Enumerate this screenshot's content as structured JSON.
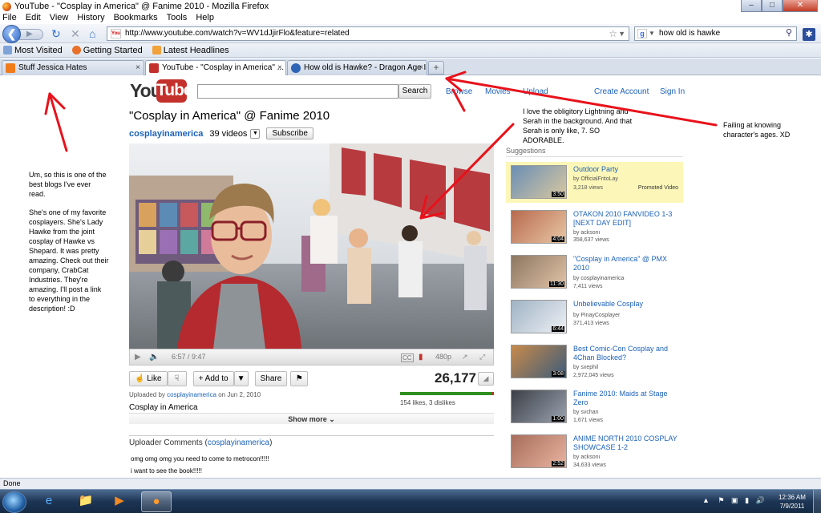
{
  "window": {
    "title": "YouTube - \"Cosplay in America\" @ Fanime 2010 - Mozilla Firefox",
    "min": "–",
    "max": "□",
    "close": "✕"
  },
  "menu": [
    "File",
    "Edit",
    "View",
    "History",
    "Bookmarks",
    "Tools",
    "Help"
  ],
  "nav": {
    "url": "http://www.youtube.com/watch?v=WV1dJjirFlo&feature=related",
    "search_value": "how old is hawke"
  },
  "bookmarks": [
    {
      "label": "Most Visited",
      "color": "#7da3d8"
    },
    {
      "label": "Getting Started",
      "color": "#e8702a"
    },
    {
      "label": "Latest Headlines",
      "color": "#f2a23a"
    }
  ],
  "tabs": [
    {
      "label": "Stuff Jessica Hates",
      "close": "×",
      "color": "#f07c1c"
    },
    {
      "label": "YouTube - \"Cosplay in America\" ...",
      "close": "×",
      "color": "#c4302b"
    },
    {
      "label": "How old is Hawke? - Dragon Age II ...",
      "close": "×",
      "color": "#2e64b5"
    }
  ],
  "youtube": {
    "logo_you": "You",
    "logo_tube": "Tube",
    "search_button": "Search",
    "links": [
      "Browse",
      "Movies",
      "Upload"
    ],
    "create_account": "Create Account",
    "sign_in": "Sign In",
    "video": {
      "title": "\"Cosplay in America\" @ Fanime 2010",
      "channel": "cosplayinamerica",
      "video_count": "39 videos",
      "subscribe": "Subscribe",
      "time": "6:57 / 9:47",
      "quality": "480p",
      "like": "Like",
      "add_to": "Add to",
      "share": "Share",
      "views": "26,177",
      "uploaded_prefix": "Uploaded by",
      "uploaded_by": "cosplayinamerica",
      "uploaded_on": "on Jun 2, 2010",
      "likes_text": "154 likes, 3 dislikes",
      "like_ratio": 0.98,
      "description": "Cosplay in America",
      "show_more": "Show more",
      "comments_title": "Uploader Comments",
      "comments_user": "cosplayinamerica",
      "comments": [
        "omg omg omg you need to come to metrocon!!!!!",
        "i want to see the book!!!!!"
      ]
    },
    "suggestions_title": "Suggestions",
    "suggestions": [
      {
        "title": "Outdoor Party",
        "by": "by OfficialFritoLay",
        "views": "3,218 views",
        "duration": "3:50",
        "promoted": "Promoted Video",
        "thumb": "#6b8fb5"
      },
      {
        "title": "OTAKON 2010 FANVIDEO 1-3 [NEXT DAY EDIT]",
        "by": "by acksonı",
        "views": "358,637 views",
        "duration": "4:04",
        "thumb": "#b96a4e"
      },
      {
        "title": "\"Cosplay in America\" @ PMX 2010",
        "by": "by cosplayinamerica",
        "views": "7,411 views",
        "duration": "11:30",
        "thumb": "#8c7660"
      },
      {
        "title": "Unbelievable Cosplay",
        "by": "by PinayCosplayer",
        "views": "371,413 views",
        "duration": "6:44",
        "thumb": "#9fb3c4"
      },
      {
        "title": "Best Comic-Con Cosplay and 4Chan Blocked?",
        "by": "by sxephil",
        "views": "2,972,045 views",
        "duration": "3:08",
        "thumb": "#c78a4a"
      },
      {
        "title": "Fanime 2010: Maids at Stage Zero",
        "by": "by svchan",
        "views": "1,671 views",
        "duration": "1:00",
        "thumb": "#3c3f47"
      },
      {
        "title": "ANIME NORTH 2010 COSPLAY SHOWCASE 1-2",
        "by": "by acksonı",
        "views": "34,633 views",
        "duration": "2:52",
        "thumb": "#a86d5c"
      }
    ]
  },
  "annotations": {
    "left_1": "Um, so this is one of the best blogs I've ever read.",
    "left_2": "She's one of my favorite cosplayers. She's Lady Hawke from the joint cosplay of Hawke vs Shepard. It was pretty amazing. Check out their company, CrabCat Industries. They're amazing. I'll post a link to everything in the description! :D",
    "middle": "I love the obligitory Lightning and Serah in the background. And that Serah is only like, 7. SO ADORABLE.",
    "right": "Failing at knowing character's ages. XD",
    "arrow_color": "#e8121b"
  },
  "status": "Done",
  "clock": {
    "time": "12:36 AM",
    "date": "7/9/2011"
  }
}
